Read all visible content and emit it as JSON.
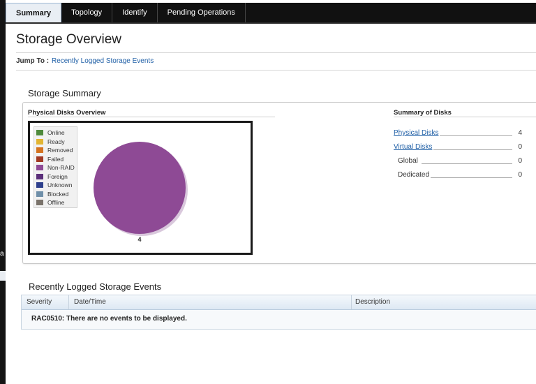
{
  "tabs": [
    {
      "label": "Summary",
      "active": true
    },
    {
      "label": "Topology",
      "active": false
    },
    {
      "label": "Identify",
      "active": false
    },
    {
      "label": "Pending Operations",
      "active": false
    }
  ],
  "page": {
    "title": "Storage Overview",
    "jump_to_label": "Jump To :",
    "jump_to_link": "Recently Logged Storage Events"
  },
  "storage_summary": {
    "title": "Storage Summary",
    "physical_disks_overview": {
      "title": "Physical Disks Overview",
      "legend": [
        {
          "label": "Online",
          "color": "#4e8a3c"
        },
        {
          "label": "Ready",
          "color": "#e2b531"
        },
        {
          "label": "Removed",
          "color": "#d5731f"
        },
        {
          "label": "Failed",
          "color": "#a23a23"
        },
        {
          "label": "Non-RAID",
          "color": "#8e4a95"
        },
        {
          "label": "Foreign",
          "color": "#5b2f7a"
        },
        {
          "label": "Unknown",
          "color": "#2d3f8c"
        },
        {
          "label": "Blocked",
          "color": "#6f8fa9"
        },
        {
          "label": "Offline",
          "color": "#7a736b"
        }
      ]
    },
    "summary_of_disks": {
      "title": "Summary of Disks",
      "rows": [
        {
          "label": "Physical Disks",
          "value": "4",
          "link": true
        },
        {
          "label": "Virtual Disks",
          "value": "0",
          "link": true
        },
        {
          "label": "Global",
          "value": "0",
          "link": false
        },
        {
          "label": "Dedicated",
          "value": "0",
          "link": false
        }
      ]
    }
  },
  "chart_data": {
    "type": "pie",
    "slices": [
      {
        "label": "Non-RAID",
        "value": 4,
        "color": "#8e4a95"
      }
    ],
    "data_labels": [
      "4"
    ]
  },
  "events": {
    "title": "Recently Logged Storage Events",
    "columns": [
      "Severity",
      "Date/Time",
      "Description"
    ],
    "empty_message": "RAC0510: There are no events to be displayed."
  }
}
